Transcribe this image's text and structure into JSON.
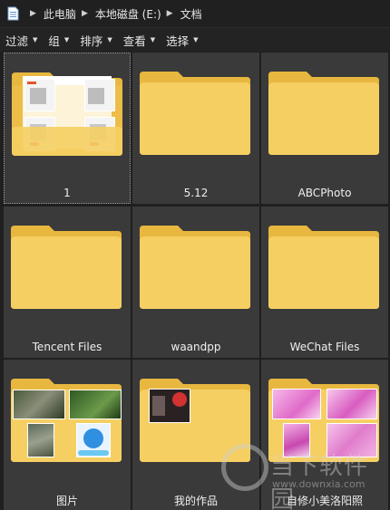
{
  "address": {
    "crumbs": [
      "此电脑",
      "本地磁盘 (E:)",
      "文档"
    ]
  },
  "toolbar": {
    "items": [
      "过滤",
      "组",
      "排序",
      "查看",
      "选择"
    ]
  },
  "tiles": [
    {
      "label": "1",
      "thumb": "web-screenshots"
    },
    {
      "label": "5.12",
      "thumb": "empty"
    },
    {
      "label": "ABCPhoto",
      "thumb": "empty"
    },
    {
      "label": "Tencent Files",
      "thumb": "empty"
    },
    {
      "label": "waandpp",
      "thumb": "empty"
    },
    {
      "label": "WeChat Files",
      "thumb": "empty"
    },
    {
      "label": "图片",
      "thumb": "photos"
    },
    {
      "label": "我的作品",
      "thumb": "artwork"
    },
    {
      "label": "自修小美洛阳照",
      "thumb": "pink-portraits"
    }
  ],
  "watermark": {
    "main": "当下软件园",
    "url": "www.downxia.com"
  },
  "colors": {
    "tile_bg": "#3a3a3a",
    "window_bg": "#1f1f1f",
    "folder_front": "#f6cf63",
    "folder_back": "#e8b73f"
  }
}
